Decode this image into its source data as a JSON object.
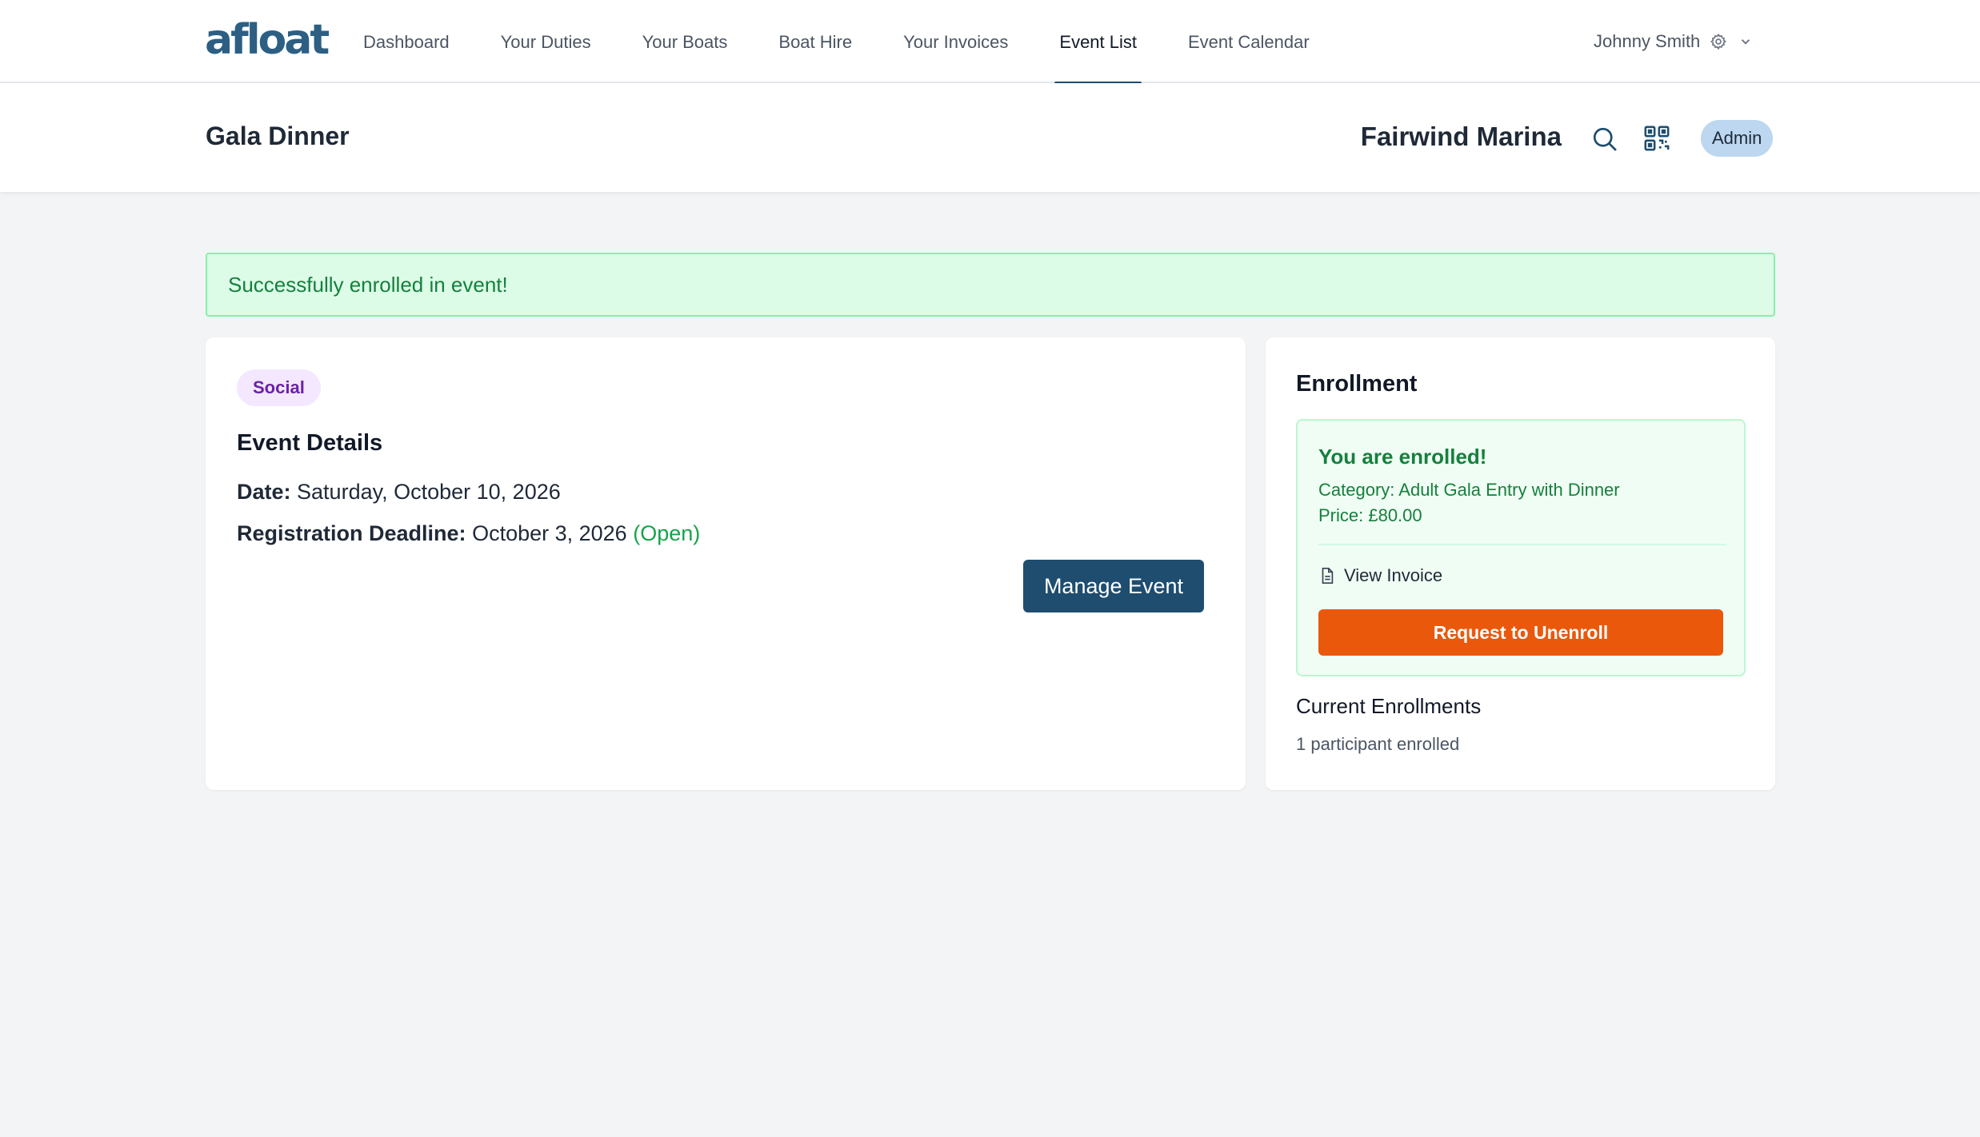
{
  "app": {
    "logo_text": "afloat"
  },
  "nav": {
    "items": [
      {
        "label": "Dashboard"
      },
      {
        "label": "Your Duties"
      },
      {
        "label": "Your Boats"
      },
      {
        "label": "Boat Hire"
      },
      {
        "label": "Your Invoices"
      },
      {
        "label": "Event List",
        "active": true
      },
      {
        "label": "Event Calendar"
      }
    ],
    "user_name": "Johnny Smith",
    "user_icons": [
      "gear-icon",
      "chevron-down-icon"
    ]
  },
  "subheader": {
    "page_title": "Gala Dinner",
    "marina_name": "Fairwind Marina",
    "role_badge": "Admin",
    "icons": [
      "search-icon",
      "qr-code-icon"
    ]
  },
  "alert": {
    "message": "Successfully enrolled in event!",
    "type": "success"
  },
  "event": {
    "category": "Social",
    "section_title": "Event Details",
    "date_label": "Date:",
    "date_value": "Saturday, October 10, 2026",
    "deadline_label": "Registration Deadline:",
    "deadline_value": "October 3, 2026",
    "deadline_status": "(Open)",
    "manage_button": "Manage Event"
  },
  "enrollment": {
    "title": "Enrollment",
    "status_heading": "You are enrolled!",
    "category_line": "Category: Adult Gala Entry with Dinner",
    "price_line": "Price: £80.00",
    "view_invoice": "View Invoice",
    "unenroll_button": "Request to Unenroll",
    "current_title": "Current Enrollments",
    "current_count": "1 participant enrolled"
  },
  "colors": {
    "brand": "#1e4d6f",
    "success": "#15803d",
    "danger_action": "#ea580c",
    "badge_purple": "#6b21a8"
  }
}
